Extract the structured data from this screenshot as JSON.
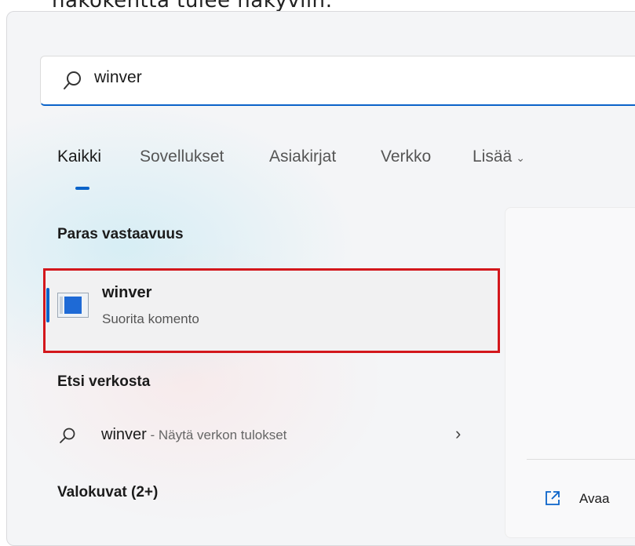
{
  "top_text": "näkökenttä tulee näkyviin:",
  "search": {
    "value": "winver"
  },
  "tabs": [
    {
      "label": "Kaikki"
    },
    {
      "label": "Sovellukset"
    },
    {
      "label": "Asiakirjat"
    },
    {
      "label": "Verkko"
    },
    {
      "label": "Lisää"
    }
  ],
  "sections": {
    "best_match": "Paras vastaavuus",
    "web": "Etsi verkosta",
    "photos": "Valokuvat (2+)"
  },
  "best_match": {
    "title": "winver",
    "subtitle": "Suorita komento"
  },
  "web_result": {
    "query": "winver",
    "hint": " - Näytä verkon tulokset"
  },
  "preview": {
    "open_label": "Avaa"
  },
  "colors": {
    "accent": "#0a63c9",
    "highlight": "#d3171c"
  },
  "icons": [
    "search-icon",
    "chevron-down-icon",
    "winver-app-icon",
    "web-search-icon",
    "chevron-right-icon",
    "open-icon"
  ]
}
